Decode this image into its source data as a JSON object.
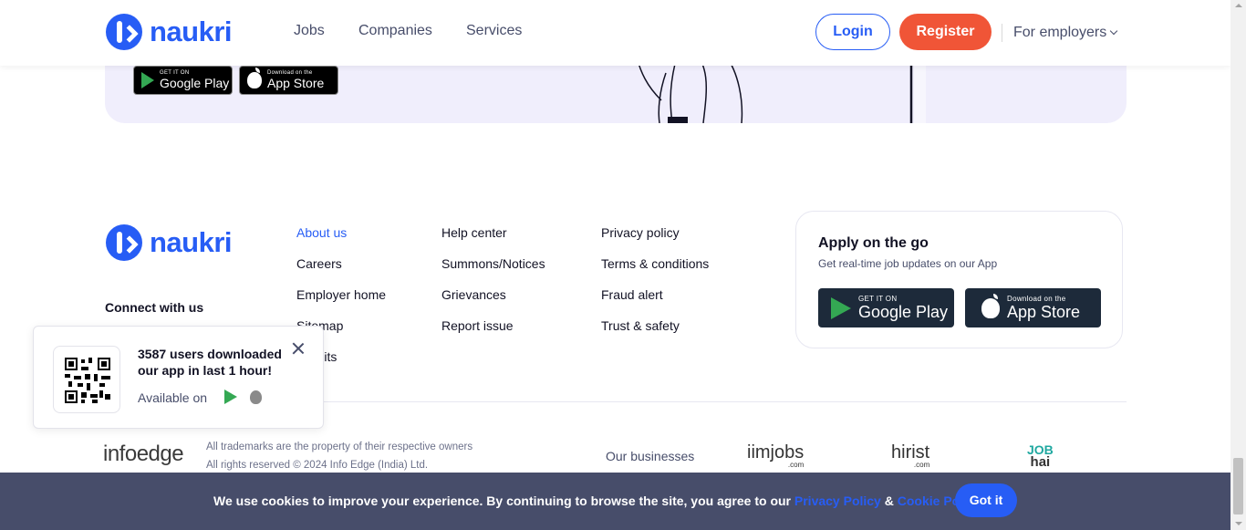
{
  "header": {
    "logo_text": "naukri",
    "nav": [
      "Jobs",
      "Companies",
      "Services"
    ],
    "login_label": "Login",
    "register_label": "Register",
    "employers_label": "For employers"
  },
  "promo": {
    "google_small": "GET IT ON",
    "google_big": "Google Play",
    "apple_small": "Download on the",
    "apple_big": "App Store"
  },
  "footer": {
    "logo_text": "naukri",
    "connect_label": "Connect with us",
    "col1": [
      "About us",
      "Careers",
      "Employer home",
      "Sitemap",
      "Credits"
    ],
    "col2": [
      "Help center",
      "Summons/Notices",
      "Grievances",
      "Report issue"
    ],
    "col3": [
      "Privacy policy",
      "Terms & conditions",
      "Fraud alert",
      "Trust & safety"
    ],
    "apply_title": "Apply on the go",
    "apply_sub": "Get real-time job updates on our App",
    "google_small": "GET IT ON",
    "google_big": "Google Play",
    "apple_small": "Download on the",
    "apple_big": "App Store",
    "infoedge": "infoedge",
    "legal_1": "All trademarks are the property of their respective owners",
    "legal_2": "All rights reserved © 2024 Info Edge (India) Ltd.",
    "our_businesses": "Our businesses",
    "businesses": [
      {
        "name": "iimjobs",
        "sub": ".com"
      },
      {
        "name": "hirist",
        "sub": ".com"
      },
      {
        "name": "JOB",
        "sub": "hai"
      }
    ]
  },
  "popup": {
    "text": "3587 users downloaded our app in last 1 hour!",
    "available": "Available on"
  },
  "cookie": {
    "text": "We use cookies to improve your experience. By continuing to browse the site, you agree to our",
    "privacy": "Privacy Policy",
    "amp": "&",
    "cookie_policy": "Cookie Policy",
    "button": "Got it"
  },
  "colors": {
    "brand_blue": "#275df5",
    "register_red": "#f05537",
    "cookie_bg": "#474d6a"
  }
}
